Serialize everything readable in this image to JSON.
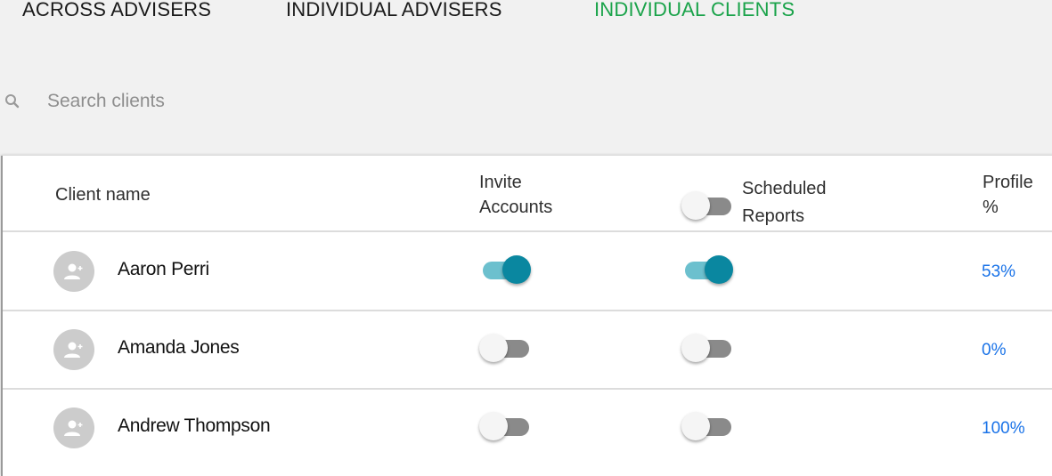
{
  "tabs": [
    {
      "label": "ACROSS ADVISERS",
      "active": false
    },
    {
      "label": "INDIVIDUAL ADVISERS",
      "active": false
    },
    {
      "label": "INDIVIDUAL CLIENTS",
      "active": true
    }
  ],
  "colors": {
    "active_tab": "#1aa34a",
    "toggle_on_thumb": "#0a87a0",
    "toggle_on_track": "#6cc0ce",
    "toggle_off_track": "#8a8a8a",
    "profile_link": "#1a73e8"
  },
  "search": {
    "icon": "search-icon",
    "placeholder": "Search clients",
    "value": ""
  },
  "table": {
    "headers": {
      "client_name": "Client name",
      "invite_line1": "Invite",
      "invite_line2": "Accounts",
      "scheduled_line1": "Scheduled",
      "scheduled_line2": "Reports",
      "profile_line1": "Profile",
      "profile_line2": "%"
    },
    "scheduled_header_toggle": false,
    "rows": [
      {
        "avatar_icon": "add-person-icon",
        "name": "Aaron Perri",
        "invite_accounts": true,
        "scheduled_reports": true,
        "profile_pct": "53%"
      },
      {
        "avatar_icon": "add-person-icon",
        "name": "Amanda Jones",
        "invite_accounts": false,
        "scheduled_reports": false,
        "profile_pct": "0%"
      },
      {
        "avatar_icon": "add-person-icon",
        "name": "Andrew Thompson",
        "invite_accounts": false,
        "scheduled_reports": false,
        "profile_pct": "100%"
      }
    ]
  }
}
